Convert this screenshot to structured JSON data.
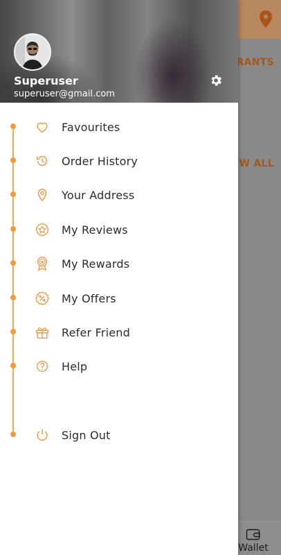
{
  "background": {
    "heading_fragment": "RANTS",
    "view_all_fragment": "EW ALL",
    "bottom_nav_wallet": "Wallet"
  },
  "drawer": {
    "user_name": "Superuser",
    "user_email": "superuser@gmail.com",
    "menu": [
      {
        "label": "Favourites",
        "icon": "heart-icon"
      },
      {
        "label": "Order History",
        "icon": "history-icon"
      },
      {
        "label": "Your Address",
        "icon": "location-pin-icon"
      },
      {
        "label": "My Reviews",
        "icon": "star-circle-icon"
      },
      {
        "label": "My Rewards",
        "icon": "medal-icon"
      },
      {
        "label": "My Offers",
        "icon": "percent-badge-icon"
      },
      {
        "label": "Refer Friend",
        "icon": "gift-icon"
      },
      {
        "label": "Help",
        "icon": "question-circle-icon"
      },
      {
        "label": "Sign Out",
        "icon": "power-icon"
      }
    ]
  },
  "colors": {
    "accent": "#ef9a3f",
    "brand_brown": "#a8561c"
  }
}
